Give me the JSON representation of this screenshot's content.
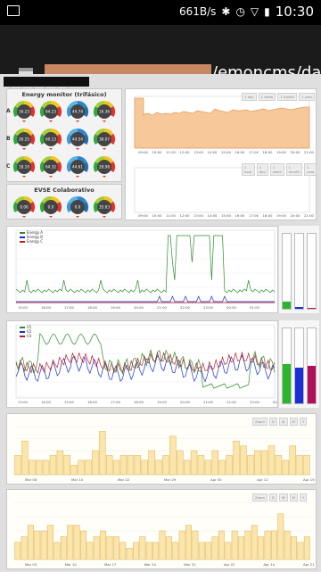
{
  "statusbar": {
    "network_speed": "661B/s",
    "time": "10:30",
    "icons": [
      "image-icon",
      "bluetooth-icon",
      "alarm-icon",
      "wifi-icon",
      "no-sim-icon",
      "battery-icon"
    ]
  },
  "browser": {
    "url_suffix": "/emoncms/da"
  },
  "dashboard": {
    "energy_monitor": {
      "title": "Energy monitor (trifásico)",
      "rows": [
        "A",
        "B",
        "C"
      ],
      "gauges": [
        [
          "16.23",
          "64.23",
          "44.74",
          "16.36"
        ],
        [
          "26.25",
          "60.13",
          "44.54",
          "38.07"
        ],
        [
          "18.10",
          "64.32",
          "44.61",
          "28.98"
        ]
      ]
    },
    "evse": {
      "title": "EVSE Colaborativo",
      "gauges": [
        "0.00",
        "0.0",
        "0.0",
        "35.63"
      ]
    },
    "top_chart": {
      "range_buttons": [
        "1 day",
        "1 week",
        "1 month",
        "1 year"
      ],
      "range_buttons_2": [
        "1 hour",
        "1 day",
        "1 week",
        "1 month",
        "1 year"
      ],
      "xticks": [
        "09:00",
        "10:00",
        "11:00",
        "12:00",
        "13:00",
        "14:00",
        "15:00",
        "16:00",
        "17:00",
        "18:00",
        "19:00",
        "20:00",
        "21:00"
      ]
    },
    "energy_chart": {
      "legend": [
        "Energy A",
        "Energy B",
        "Energy C"
      ],
      "colors": [
        "#2e8b2e",
        "#1a2fd6",
        "#c21d1d"
      ],
      "xticks": [
        "15:00",
        "16:00",
        "17:00",
        "18:00",
        "19:00",
        "20:00",
        "21:00",
        "22:00",
        "23:00",
        "00:00",
        "01:00"
      ]
    },
    "voltage_chart": {
      "legend": [
        "V1",
        "V2",
        "V3"
      ],
      "colors": [
        "#2e8b2e",
        "#1a2fd6",
        "#c21d1d"
      ],
      "xticks": [
        "13:00",
        "14:00",
        "15:00",
        "16:00",
        "17:00",
        "18:00",
        "19:00",
        "20:00",
        "21:00",
        "22:00",
        "23:00",
        "00:00"
      ]
    },
    "bar_chart_1": {
      "buttons": [
        "Zoom",
        "D",
        "W",
        "M",
        "Y"
      ],
      "xticks": [
        "Mar 08",
        "Mar 15",
        "Mar 22",
        "Mar 29",
        "Apr 05",
        "Apr 12",
        "Apr 19"
      ],
      "values": [
        4,
        7,
        3,
        3,
        3,
        4,
        5,
        4,
        2,
        3,
        3,
        5,
        9,
        4,
        3,
        4,
        4,
        4,
        3,
        5,
        3,
        4,
        8,
        5,
        3,
        5,
        4,
        3,
        5,
        3,
        4,
        7,
        6,
        4,
        5,
        5,
        6,
        4,
        3,
        6,
        4,
        4
      ]
    },
    "bar_chart_2": {
      "buttons": [
        "Zoom",
        "D",
        "W",
        "M",
        "Y"
      ],
      "xticks": [
        "Mar 03",
        "Mar 10",
        "Mar 17",
        "Mar 24",
        "Mar 31",
        "Apr 07",
        "Apr 14",
        "Apr 21"
      ],
      "values": [
        3,
        4,
        6,
        5,
        5,
        6,
        3,
        4,
        6,
        6,
        5,
        3,
        4,
        5,
        4,
        4,
        3,
        2,
        3,
        4,
        3,
        3,
        5,
        4,
        3,
        5,
        6,
        5,
        3,
        3,
        4,
        5,
        3,
        5,
        4,
        5,
        6,
        4,
        5,
        5,
        8,
        5,
        4,
        3,
        4
      ]
    }
  }
}
